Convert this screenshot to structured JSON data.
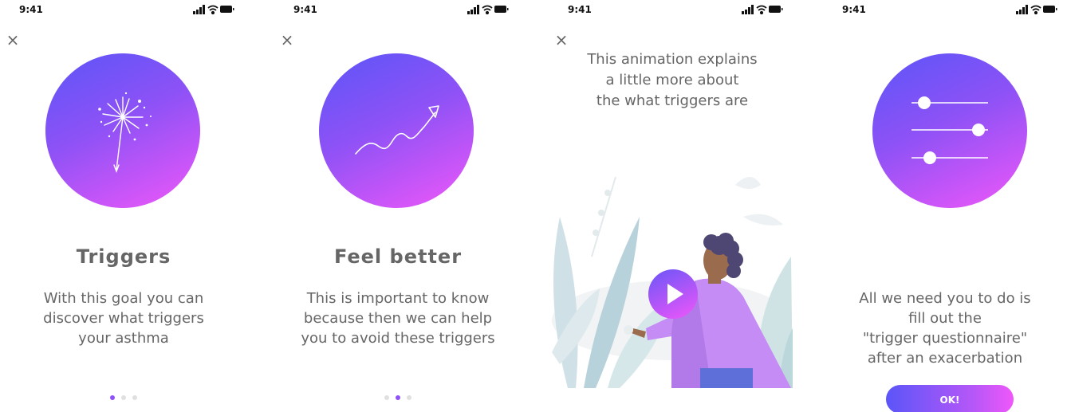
{
  "status": {
    "time": "9:41"
  },
  "close_icon": "×",
  "screens": [
    {
      "title": "Triggers",
      "body": [
        "With this goal you can",
        "discover what triggers",
        "your asthma"
      ],
      "illustration_icon": "sparkler-icon",
      "pagination": {
        "active": 1,
        "total": 3
      }
    },
    {
      "title": "Feel better",
      "body": [
        "This is important to know",
        "because then we can help",
        "you to avoid these triggers"
      ],
      "illustration_icon": "trend-up-icon",
      "pagination": {
        "active": 2,
        "total": 3
      }
    },
    {
      "intro": [
        "This animation explains",
        "a little more about",
        "the what triggers are"
      ],
      "illustration_icon": "play-icon"
    },
    {
      "body": [
        "All we need you to do is",
        "fill out the",
        "\"trigger questionnaire\"",
        "after an exacerbation"
      ],
      "illustration_icon": "sliders-icon",
      "button_label": "OK!"
    }
  ],
  "colors": {
    "gradient_start": "#5b55f8",
    "gradient_end": "#f057f9",
    "text": "#666666"
  }
}
